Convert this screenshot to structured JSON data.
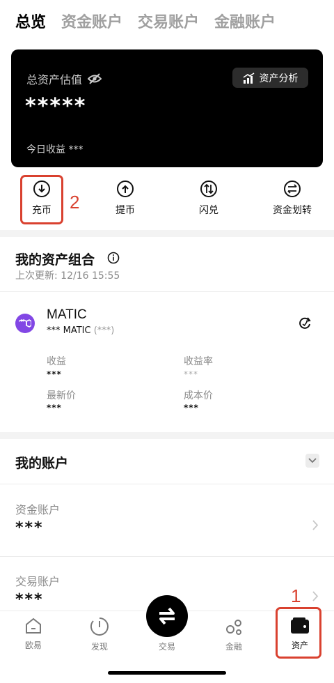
{
  "tabs": [
    "总览",
    "资金账户",
    "交易账户",
    "金融账户"
  ],
  "card": {
    "title": "总资产估值",
    "value": "*****",
    "today_label": "今日收益",
    "today_value": "***",
    "analysis_label": "资产分析"
  },
  "actions": [
    {
      "label": "充币",
      "icon": "deposit-icon"
    },
    {
      "label": "提币",
      "icon": "withdraw-icon"
    },
    {
      "label": "闪兑",
      "icon": "convert-icon"
    },
    {
      "label": "资金划转",
      "icon": "transfer-icon"
    }
  ],
  "annotations": {
    "num1": "1",
    "num2": "2",
    "color": "#d9412f"
  },
  "portfolio": {
    "title": "我的资产组合",
    "updated": "上次更新: 12/16 15:55",
    "coin": {
      "name": "MATIC",
      "amount": "*** MATIC",
      "amount_extra": "(***)",
      "color": "#8247e5"
    },
    "stats": {
      "profit_label": "收益",
      "profit_value": "***",
      "rate_label": "收益率",
      "rate_value": "***",
      "price_label": "最新价",
      "price_value": "***",
      "cost_label": "成本价",
      "cost_value": "***"
    }
  },
  "accounts": {
    "title": "我的账户",
    "items": [
      {
        "label": "资金账户",
        "value": "***"
      },
      {
        "label": "交易账户",
        "value": "***"
      }
    ]
  },
  "nav": {
    "items": [
      {
        "label": "欧易",
        "icon": "home-icon"
      },
      {
        "label": "发现",
        "icon": "discover-icon"
      },
      {
        "label": "交易",
        "icon": "trade-swap-icon"
      },
      {
        "label": "金融",
        "icon": "finance-icon"
      },
      {
        "label": "资产",
        "icon": "wallet-icon"
      }
    ]
  }
}
